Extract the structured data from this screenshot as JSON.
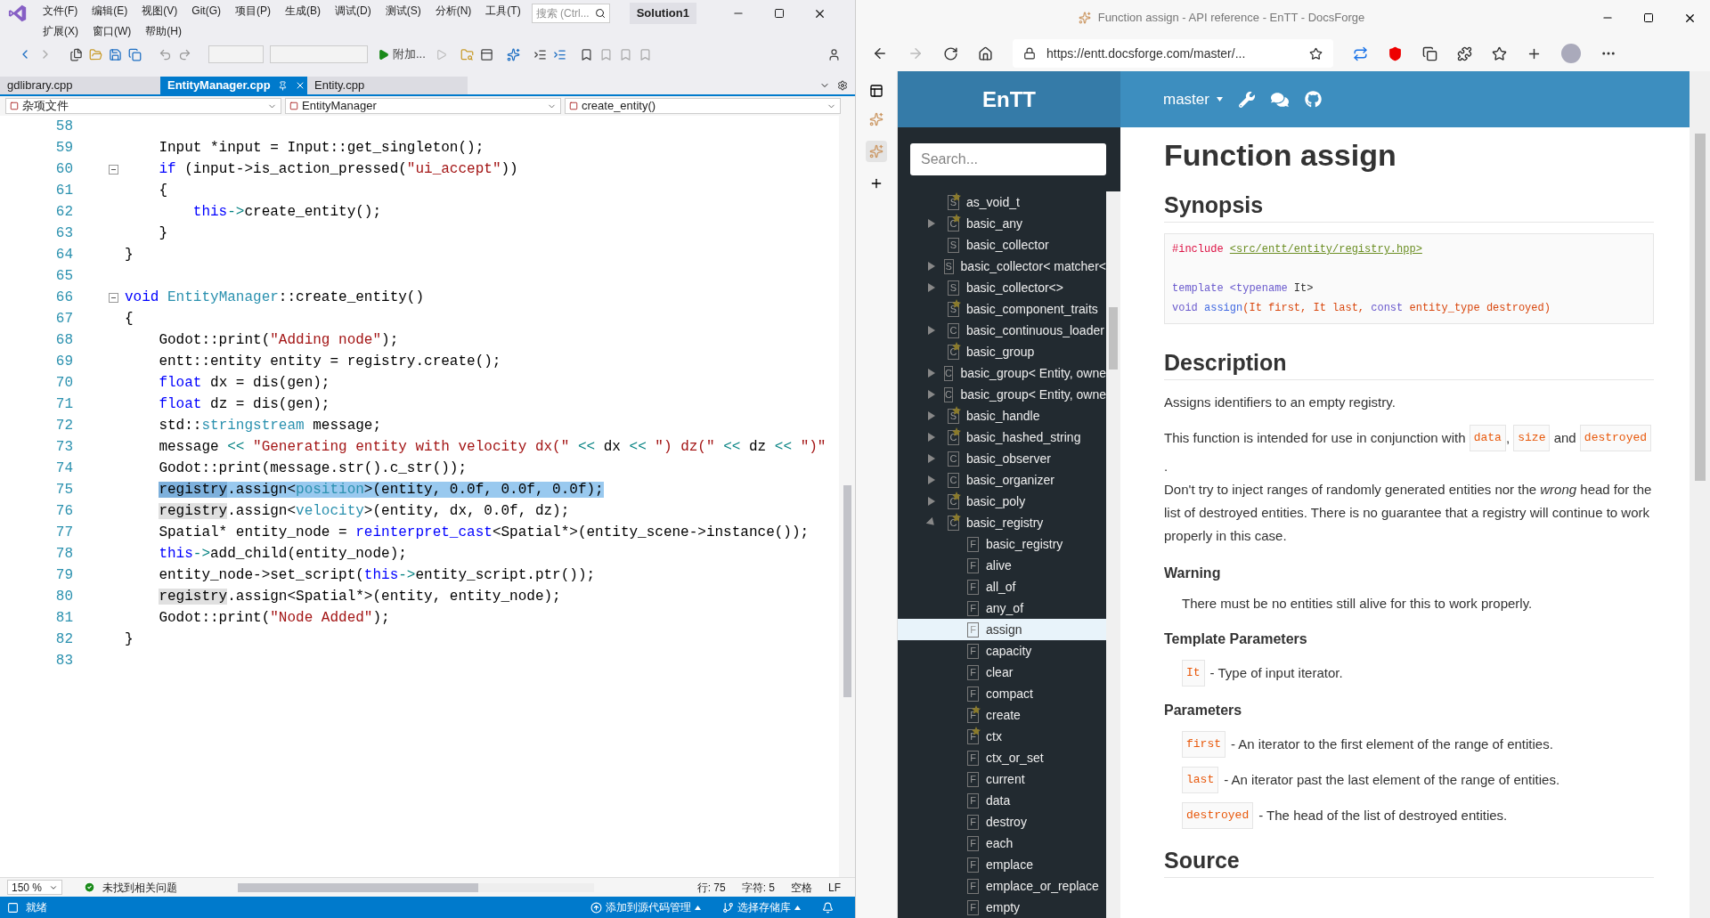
{
  "vs": {
    "menu_row1": [
      "文件(F)",
      "编辑(E)",
      "视图(V)",
      "Git(G)",
      "项目(P)",
      "生成(B)",
      "调试(D)",
      "测试(S)",
      "分析(N)",
      "工具(T)"
    ],
    "menu_row2": [
      "扩展(X)",
      "窗口(W)",
      "帮助(H)"
    ],
    "search": {
      "placeholder": "搜索 (Ctrl..."
    },
    "solution": "Solution1",
    "attach": "附加...",
    "tabs": [
      {
        "label": "gdlibrary.cpp",
        "selected": false
      },
      {
        "label": "EntityManager.cpp",
        "selected": true
      },
      {
        "label": "Entity.cpp",
        "selected": false
      }
    ],
    "nav": [
      "杂项文件",
      "EntityManager",
      "create_entity()"
    ],
    "code_lines": [
      {
        "num": "58",
        "fold": false
      },
      {
        "num": "59",
        "fold": false,
        "tokens": [
          {
            "kind": "plain",
            "text": "    Input *input = Input::get_singleton();"
          }
        ]
      },
      {
        "num": "60",
        "fold": true,
        "tokens": [
          {
            "kind": "keyword",
            "text": "    if"
          },
          {
            "kind": "plain",
            "text": " (input->is_action_pressed("
          },
          {
            "kind": "string",
            "text": "\"ui_accept\""
          },
          {
            "kind": "plain",
            "text": "))"
          }
        ]
      },
      {
        "num": "61",
        "fold": false,
        "tokens": [
          {
            "kind": "plain",
            "text": "    {"
          }
        ]
      },
      {
        "num": "62",
        "fold": false,
        "tokens": [
          {
            "kind": "keyword",
            "text": "        this"
          },
          {
            "kind": "operator",
            "text": "->"
          },
          {
            "kind": "plain",
            "text": "create_entity();"
          }
        ]
      },
      {
        "num": "63",
        "fold": false,
        "tokens": [
          {
            "kind": "plain",
            "text": "    }"
          }
        ]
      },
      {
        "num": "64",
        "fold": false,
        "tokens": [
          {
            "kind": "plain",
            "text": "}"
          }
        ]
      },
      {
        "num": "65",
        "fold": false
      },
      {
        "num": "66",
        "fold": true,
        "tokens": [
          {
            "kind": "keyword",
            "text": "void"
          },
          {
            "kind": "type",
            "text": " EntityManager"
          },
          {
            "kind": "plain",
            "text": "::create_entity()"
          }
        ]
      },
      {
        "num": "67",
        "fold": false,
        "tokens": [
          {
            "kind": "plain",
            "text": "{"
          }
        ]
      },
      {
        "num": "68",
        "fold": false,
        "tokens": [
          {
            "kind": "plain",
            "text": "    Godot::print("
          },
          {
            "kind": "string",
            "text": "\"Adding node\""
          },
          {
            "kind": "plain",
            "text": ");"
          }
        ]
      },
      {
        "num": "69",
        "fold": false,
        "tokens": [
          {
            "kind": "plain",
            "text": "    entt::entity entity = registry.create();"
          }
        ]
      },
      {
        "num": "70",
        "fold": false,
        "tokens": [
          {
            "kind": "keyword",
            "text": "    float"
          },
          {
            "kind": "plain",
            "text": " dx = dis(gen);"
          }
        ]
      },
      {
        "num": "71",
        "fold": false,
        "tokens": [
          {
            "kind": "keyword",
            "text": "    float"
          },
          {
            "kind": "plain",
            "text": " dz = dis(gen);"
          }
        ]
      },
      {
        "num": "72",
        "fold": false,
        "tokens": [
          {
            "kind": "plain",
            "text": "    std::"
          },
          {
            "kind": "type",
            "text": "stringstream"
          },
          {
            "kind": "plain",
            "text": " message;"
          }
        ]
      },
      {
        "num": "73",
        "fold": false,
        "tokens": [
          {
            "kind": "plain",
            "text": "    message"
          },
          {
            "kind": "operator",
            "text": " <<"
          },
          {
            "kind": "string",
            "text": " \"Generating entity with velocity dx(\""
          },
          {
            "kind": "operator",
            "text": " <<"
          },
          {
            "kind": "plain",
            "text": " dx"
          },
          {
            "kind": "operator",
            "text": " <<"
          },
          {
            "kind": "string",
            "text": " \") dz(\""
          },
          {
            "kind": "operator",
            "text": " <<"
          },
          {
            "kind": "plain",
            "text": " dz"
          },
          {
            "kind": "operator",
            "text": " <<"
          },
          {
            "kind": "string",
            "text": " \")\""
          }
        ]
      },
      {
        "num": "74",
        "fold": false,
        "tokens": [
          {
            "kind": "plain",
            "text": "    Godot::print(message.str().c_str());"
          }
        ]
      },
      {
        "num": "75",
        "fold": false,
        "tokens": [
          {
            "kind": "plain",
            "text": "    registry",
            "selected": true,
            "highlighted": true
          },
          {
            "kind": "plain",
            "text": ".assign<",
            "selected": true,
            "highlighted": false
          },
          {
            "kind": "type",
            "text": "position",
            "selected": true,
            "highlighted": false
          },
          {
            "kind": "plain",
            "text": ">(entity, 0.0f, 0.0f, 0.0f);",
            "selected": true,
            "highlighted": false
          }
        ]
      },
      {
        "num": "76",
        "fold": false,
        "tokens": [
          {
            "kind": "plain",
            "text": "    registry",
            "selected": false,
            "highlighted": true
          },
          {
            "kind": "plain",
            "text": ".assign<",
            "selected": false,
            "highlighted": false
          },
          {
            "kind": "type",
            "text": "velocity",
            "selected": false,
            "highlighted": false
          },
          {
            "kind": "plain",
            "text": ">(entity, dx, 0.0f, dz);",
            "selected": false,
            "highlighted": false
          }
        ]
      },
      {
        "num": "77",
        "fold": false,
        "tokens": [
          {
            "kind": "plain",
            "text": "    Spatial* entity_node = "
          },
          {
            "kind": "keyword",
            "text": "reinterpret_cast"
          },
          {
            "kind": "plain",
            "text": "<Spatial*>(entity_scene->instance());"
          }
        ]
      },
      {
        "num": "78",
        "fold": false,
        "tokens": [
          {
            "kind": "keyword",
            "text": "    this"
          },
          {
            "kind": "operator",
            "text": "->"
          },
          {
            "kind": "plain",
            "text": "add_child(entity_node);"
          }
        ]
      },
      {
        "num": "79",
        "fold": false,
        "tokens": [
          {
            "kind": "plain",
            "text": "    entity_node->set_script("
          },
          {
            "kind": "keyword",
            "text": "this"
          },
          {
            "kind": "operator",
            "text": "->"
          },
          {
            "kind": "plain",
            "text": "entity_script.ptr());"
          }
        ]
      },
      {
        "num": "80",
        "fold": false,
        "tokens": [
          {
            "kind": "plain",
            "text": "    registry",
            "selected": false,
            "highlighted": true
          },
          {
            "kind": "plain",
            "text": ".assign<Spatial*>(entity, entity_node);",
            "selected": false,
            "highlighted": false
          }
        ]
      },
      {
        "num": "81",
        "fold": false,
        "tokens": [
          {
            "kind": "plain",
            "text": "    Godot::print("
          },
          {
            "kind": "string",
            "text": "\"Node Added\""
          },
          {
            "kind": "plain",
            "text": ");"
          }
        ]
      },
      {
        "num": "82",
        "fold": false,
        "tokens": [
          {
            "kind": "plain",
            "text": "}"
          }
        ]
      },
      {
        "num": "83",
        "fold": false
      }
    ],
    "zoom": "150 %",
    "issues": "未找到相关问题",
    "position": [
      "行: 75",
      "字符: 5",
      "空格",
      "LF"
    ],
    "status": "就绪",
    "source_control": "添加到源代码管理",
    "repository": "选择存储库"
  },
  "browser": {
    "title": "Function assign - API reference - EnTT - DocsForge",
    "url": "https://entt.docsforge.com/master/...",
    "brand": "EnTT",
    "version": "master",
    "search": {
      "placeholder": "Search..."
    },
    "tree": [
      {
        "label": "as_void_t",
        "badge": "S",
        "starred": true,
        "selected": false
      },
      {
        "label": "basic_any",
        "badge": "C",
        "starred": true,
        "selected": false,
        "expanded": false
      },
      {
        "label": "basic_collector",
        "badge": "S",
        "starred": false,
        "selected": false
      },
      {
        "label": "basic_collector< matcher<",
        "badge": "S",
        "starred": false,
        "selected": false,
        "expanded": false
      },
      {
        "label": "basic_collector<>",
        "badge": "S",
        "starred": false,
        "selected": false,
        "expanded": false
      },
      {
        "label": "basic_component_traits",
        "badge": "S",
        "starred": true,
        "selected": false
      },
      {
        "label": "basic_continuous_loader",
        "badge": "C",
        "starred": false,
        "selected": false,
        "expanded": false
      },
      {
        "label": "basic_group",
        "badge": "C",
        "starred": true,
        "selected": false
      },
      {
        "label": "basic_group< Entity, owne",
        "badge": "C",
        "starred": false,
        "selected": false,
        "expanded": false
      },
      {
        "label": "basic_group< Entity, owne",
        "badge": "C",
        "starred": false,
        "selected": false,
        "expanded": false
      },
      {
        "label": "basic_handle",
        "badge": "S",
        "starred": true,
        "selected": false,
        "expanded": false
      },
      {
        "label": "basic_hashed_string",
        "badge": "C",
        "starred": true,
        "selected": false,
        "expanded": false
      },
      {
        "label": "basic_observer",
        "badge": "C",
        "starred": false,
        "selected": false,
        "expanded": false
      },
      {
        "label": "basic_organizer",
        "badge": "C",
        "starred": false,
        "selected": false,
        "expanded": false
      },
      {
        "label": "basic_poly",
        "badge": "C",
        "starred": true,
        "selected": false,
        "expanded": false
      },
      {
        "label": "basic_registry",
        "badge": "C",
        "starred": true,
        "selected": false,
        "expanded": true,
        "children": [
          {
            "label": "basic_registry",
            "badge": "F",
            "starred": false,
            "selected": false
          },
          {
            "label": "alive",
            "badge": "F",
            "starred": false,
            "selected": false
          },
          {
            "label": "all_of",
            "badge": "F",
            "starred": false,
            "selected": false
          },
          {
            "label": "any_of",
            "badge": "F",
            "starred": false,
            "selected": false
          },
          {
            "label": "assign",
            "badge": "F",
            "starred": false,
            "selected": true
          },
          {
            "label": "capacity",
            "badge": "F",
            "starred": false,
            "selected": false
          },
          {
            "label": "clear",
            "badge": "F",
            "starred": false,
            "selected": false
          },
          {
            "label": "compact",
            "badge": "F",
            "starred": false,
            "selected": false
          },
          {
            "label": "create",
            "badge": "F",
            "starred": true,
            "selected": false
          },
          {
            "label": "ctx",
            "badge": "F",
            "starred": true,
            "selected": false
          },
          {
            "label": "ctx_or_set",
            "badge": "F",
            "starred": false,
            "selected": false
          },
          {
            "label": "current",
            "badge": "F",
            "starred": false,
            "selected": false
          },
          {
            "label": "data",
            "badge": "F",
            "starred": false,
            "selected": false
          },
          {
            "label": "destroy",
            "badge": "F",
            "starred": false,
            "selected": false
          },
          {
            "label": "each",
            "badge": "F",
            "starred": false,
            "selected": false
          },
          {
            "label": "emplace",
            "badge": "F",
            "starred": false,
            "selected": false
          },
          {
            "label": "emplace_or_replace",
            "badge": "F",
            "starred": false,
            "selected": false
          },
          {
            "label": "empty",
            "badge": "F",
            "starred": false,
            "selected": false
          }
        ]
      }
    ],
    "page": {
      "title": "Function assign",
      "synopsis_heading": "Synopsis",
      "synopsis_code": [
        {
          "kind": "code",
          "tokens": [
            {
              "kind": "preprocessor",
              "text": "#include"
            },
            {
              "kind": "link",
              "text": " <src/entt/entity/registry.hpp>"
            }
          ]
        },
        {
          "kind": "blank"
        },
        {
          "kind": "code",
          "tokens": [
            {
              "kind": "keyword",
              "text": "template"
            },
            {
              "kind": "keyword",
              "text": " <typename"
            },
            {
              "kind": "plain",
              "text": " It>"
            }
          ]
        },
        {
          "kind": "code",
          "tokens": [
            {
              "kind": "keyword",
              "text": "void"
            },
            {
              "kind": "function",
              "text": " assign"
            },
            {
              "kind": "argument",
              "text": "(It first, It last, "
            },
            {
              "kind": "keyword",
              "text": "const"
            },
            {
              "kind": "argument",
              "text": " entity_type destroyed)"
            }
          ]
        }
      ],
      "description_heading": "Description",
      "description": [
        [
          {
            "kind": "text",
            "text": "Assigns identifiers to an empty registry."
          }
        ],
        [
          {
            "kind": "text",
            "text": "This function is intended for use in conjunction with "
          },
          {
            "kind": "code",
            "text": "data"
          },
          {
            "kind": "text",
            "text": ", "
          },
          {
            "kind": "code",
            "text": "size"
          },
          {
            "kind": "text",
            "text": " and "
          },
          {
            "kind": "code",
            "text": "destroyed"
          },
          {
            "kind": "text",
            "text": "."
          }
        ]
      ],
      "note": "Don't try to inject ranges of randomly generated entities nor the *wrong* head for the list of destroyed entities. There is no guarantee that a registry will continue to work properly in this case.",
      "warning_heading": "Warning",
      "warning": "There must be no entities still alive for this to work properly.",
      "template_parameters_heading": "Template Parameters",
      "template_parameters": [
        {
          "name": "It",
          "desc": "- Type of input iterator."
        }
      ],
      "parameters_heading": "Parameters",
      "parameters": [
        {
          "name": "first",
          "desc": "- An iterator to the first element of the range of entities."
        },
        {
          "name": "last",
          "desc": "- An iterator past the last element of the range of entities."
        },
        {
          "name": "destroyed",
          "desc": "- The head of the list of destroyed entities."
        }
      ],
      "source_heading": "Source"
    }
  }
}
